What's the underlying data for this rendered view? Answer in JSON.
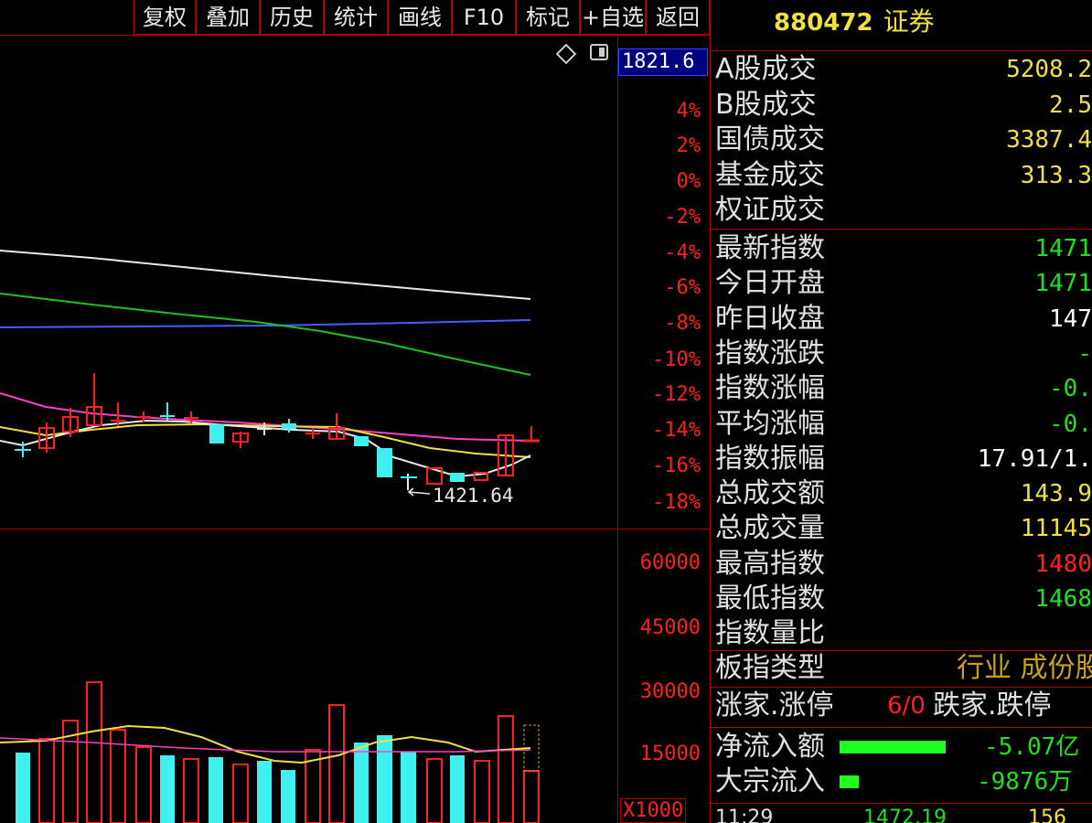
{
  "toolbar": {
    "items": [
      "复权",
      "叠加",
      "历史",
      "统计",
      "画线",
      "F10",
      "标记",
      "+自选",
      "返回"
    ]
  },
  "header": {
    "code": "880472",
    "name": "证券"
  },
  "price_panel": {
    "current_price": "1821.6",
    "pct_ticks": [
      "4%",
      "2%",
      "0%",
      "-2%",
      "-4%",
      "-6%",
      "-8%",
      "-10%",
      "-12%",
      "-14%",
      "-16%",
      "-18%"
    ],
    "low_annotation": "1421.64",
    "icons": [
      "diamond-icon",
      "window-toggle-icon"
    ]
  },
  "volume_panel": {
    "ticks": [
      "60000",
      "45000",
      "30000",
      "15000"
    ],
    "unit": "X1000"
  },
  "info": {
    "section1": [
      {
        "label": "A股成交",
        "value": "5208.2",
        "color": "#f0e040"
      },
      {
        "label": "B股成交",
        "value": "2.5",
        "color": "#f0e040"
      },
      {
        "label": "国债成交",
        "value": "3387.4",
        "color": "#f0e040"
      },
      {
        "label": "基金成交",
        "value": "313.3",
        "color": "#f0e040"
      },
      {
        "label": "权证成交",
        "value": "",
        "color": "#f0e040"
      }
    ],
    "section2": [
      {
        "label": "最新指数",
        "value": "1471",
        "color": "#20e020"
      },
      {
        "label": "今日开盘",
        "value": "1471",
        "color": "#20e020"
      },
      {
        "label": "昨日收盘",
        "value": "147",
        "color": "#ffffff"
      },
      {
        "label": "指数涨跌",
        "value": "-",
        "color": "#20e020"
      },
      {
        "label": "指数涨幅",
        "value": "-0.",
        "color": "#20e020"
      },
      {
        "label": "平均涨幅",
        "value": "-0.",
        "color": "#20e020"
      },
      {
        "label": "指数振幅",
        "value": "17.91/1.",
        "color": "#ffffff"
      },
      {
        "label": "总成交额",
        "value": "143.9",
        "color": "#f0e040"
      },
      {
        "label": "总成交量",
        "value": "11145",
        "color": "#f0e040"
      },
      {
        "label": "最高指数",
        "value": "1480",
        "color": "#ff2020"
      },
      {
        "label": "最低指数",
        "value": "1468",
        "color": "#20e020"
      },
      {
        "label": "指数量比",
        "value": "",
        "color": "#ffffff"
      }
    ],
    "type_label": "板指类型",
    "type_value": "行业 成份股",
    "rise_label": "涨家.涨停",
    "rise_value": "6/0",
    "fall_label": "跌家.跌停",
    "netflow_label": "净流入额",
    "netflow_value": "-5.07亿",
    "netflow_bar_fraction": 0.28,
    "block_label": "大宗流入",
    "block_value": "-9876万",
    "block_bar_fraction": 0.05,
    "bottom_time": "11:29",
    "bottom_price": "1472.19",
    "bottom_vol": "156"
  },
  "colors": {
    "up": "#ff2020",
    "down": "#40f0f0",
    "grid": "#b00000",
    "ma_white": "#e8e8e8",
    "ma_yellow": "#f0e040",
    "ma_magenta": "#ff40c0",
    "ma_green": "#20c020",
    "ma_blue": "#4060ff",
    "flow": "#20ff20"
  }
}
